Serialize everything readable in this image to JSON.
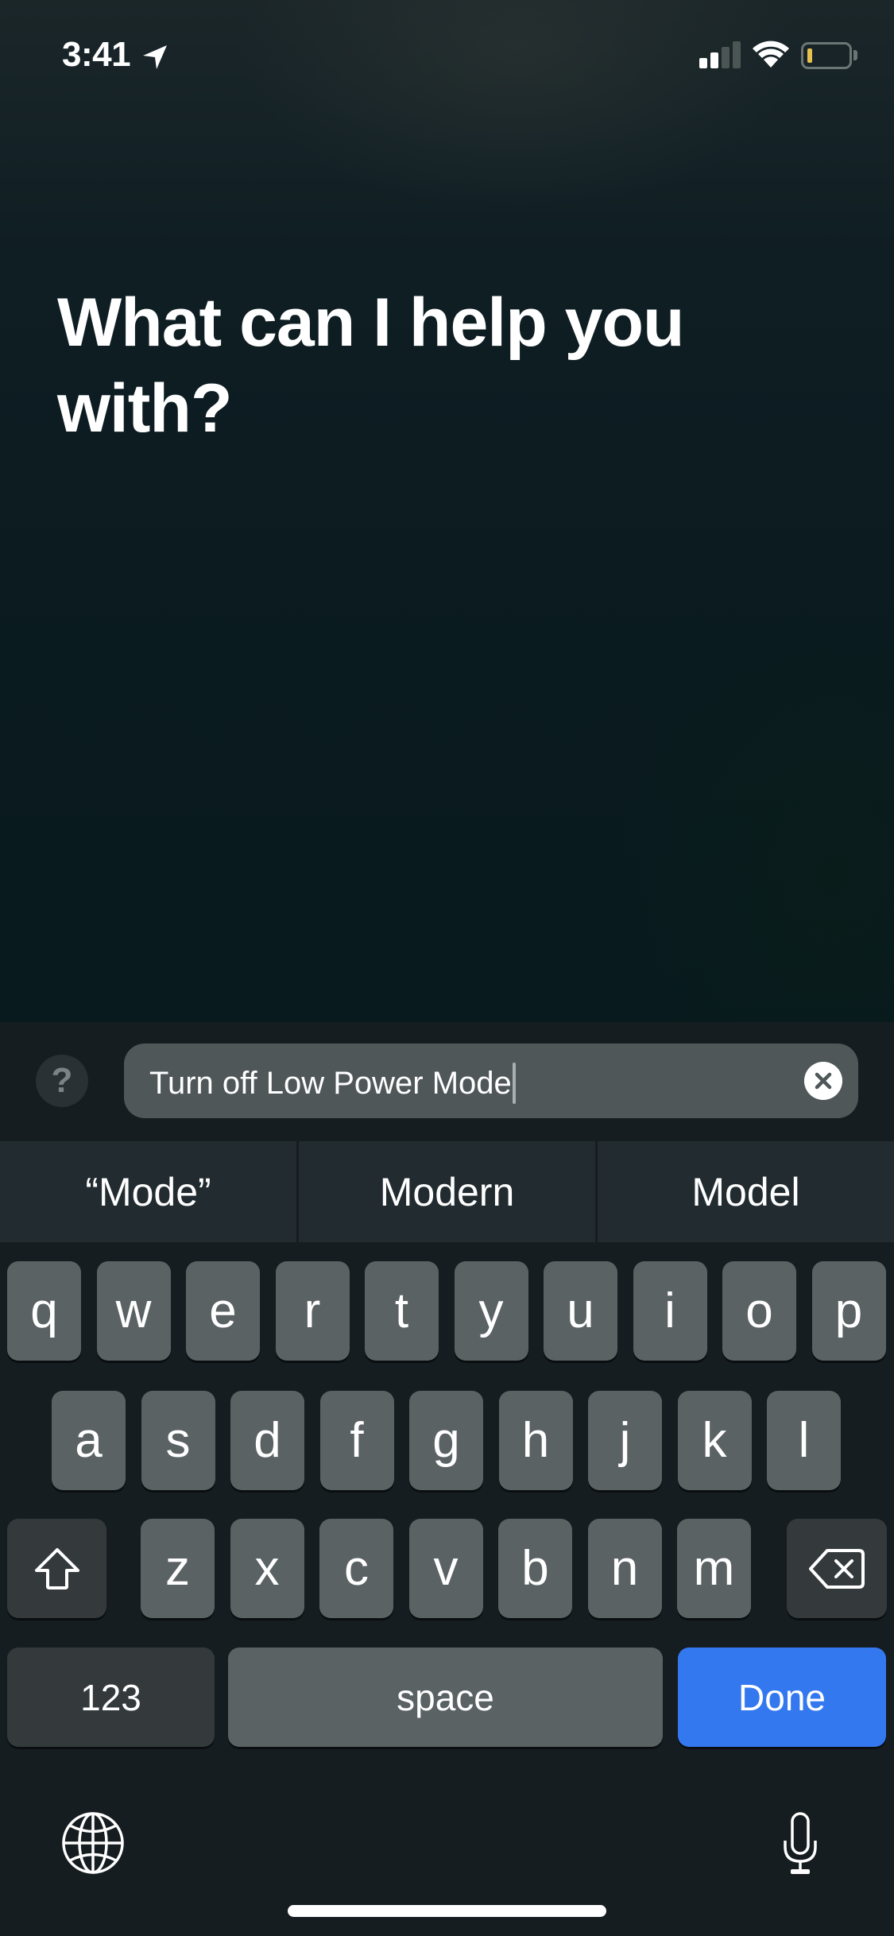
{
  "status_bar": {
    "time": "3:41",
    "location_icon": "location-arrow-icon",
    "signal_bars_total": 4,
    "signal_bars_active": 2,
    "wifi_icon": "wifi-icon",
    "battery_level_fraction": 0.08,
    "battery_color": "#e8c24e"
  },
  "siri": {
    "prompt": "What can I help you with?"
  },
  "input_bar": {
    "help_label": "?",
    "query_value": "Turn off Low Power Mode",
    "clear_icon": "clear-circle-icon"
  },
  "suggestions": [
    "“Mode”",
    "Modern",
    "Model"
  ],
  "keyboard": {
    "row1": [
      "q",
      "w",
      "e",
      "r",
      "t",
      "y",
      "u",
      "i",
      "o",
      "p"
    ],
    "row2": [
      "a",
      "s",
      "d",
      "f",
      "g",
      "h",
      "j",
      "k",
      "l"
    ],
    "row3": [
      "z",
      "x",
      "c",
      "v",
      "b",
      "n",
      "m"
    ],
    "shift_icon": "shift-icon",
    "delete_icon": "delete-icon",
    "numbers_label": "123",
    "space_label": "space",
    "done_label": "Done",
    "done_color": "#3478f0",
    "globe_icon": "globe-icon",
    "mic_icon": "microphone-icon"
  }
}
